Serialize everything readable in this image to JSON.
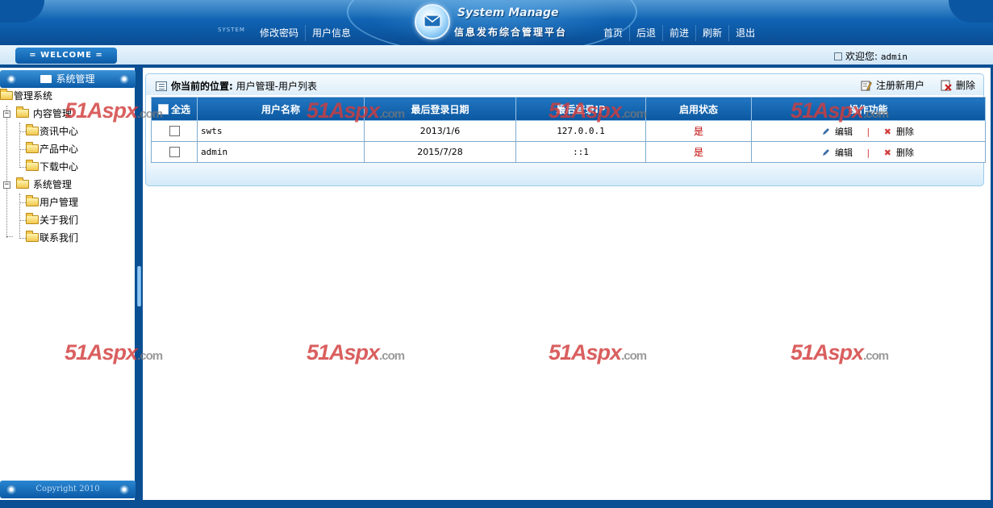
{
  "header": {
    "brand_en": "System Manage",
    "brand_cn": "信息发布综合管理平台",
    "system_mini": "SYSTEM",
    "nav_left": [
      "修改密码",
      "用户信息"
    ],
    "nav_right": [
      "首页",
      "后退",
      "前进",
      "刷新",
      "退出"
    ]
  },
  "welcome": {
    "tab_label": "= WELCOME =",
    "greeting": "欢迎您:",
    "user": "admin"
  },
  "sidebar": {
    "title": "系统管理",
    "copyright": "Copyright 2010",
    "tree": {
      "root": "管理系统",
      "groups": [
        {
          "label": "内容管理",
          "children": [
            "资讯中心",
            "产品中心",
            "下载中心"
          ]
        },
        {
          "label": "系统管理",
          "children": [
            "用户管理",
            "关于我们",
            "联系我们"
          ]
        }
      ]
    }
  },
  "main": {
    "breadcrumb_label": "你当前的位置:",
    "breadcrumb_path": "用户管理-用户列表",
    "actions": {
      "register": "注册新用户",
      "delete": "删除"
    },
    "table": {
      "select_all": "全选",
      "columns": [
        "用户名称",
        "最后登录日期",
        "最后登录IP",
        "启用状态",
        "操作功能"
      ],
      "rows": [
        {
          "name": "swts",
          "date": "2013/1/6",
          "ip": "127.0.0.1",
          "status": "是"
        },
        {
          "name": "admin",
          "date": "2015/7/28",
          "ip": "::1",
          "status": "是"
        }
      ],
      "op_edit": "编辑",
      "op_delete": "删除",
      "op_sep": "|"
    }
  },
  "watermark": {
    "text": "51Aspx",
    "suffix": ".com"
  },
  "colors": {
    "primary": "#0a4f93",
    "header_blue": "#1b77c4",
    "status_red": "#c00000",
    "watermark_red": "#d23c3c"
  }
}
